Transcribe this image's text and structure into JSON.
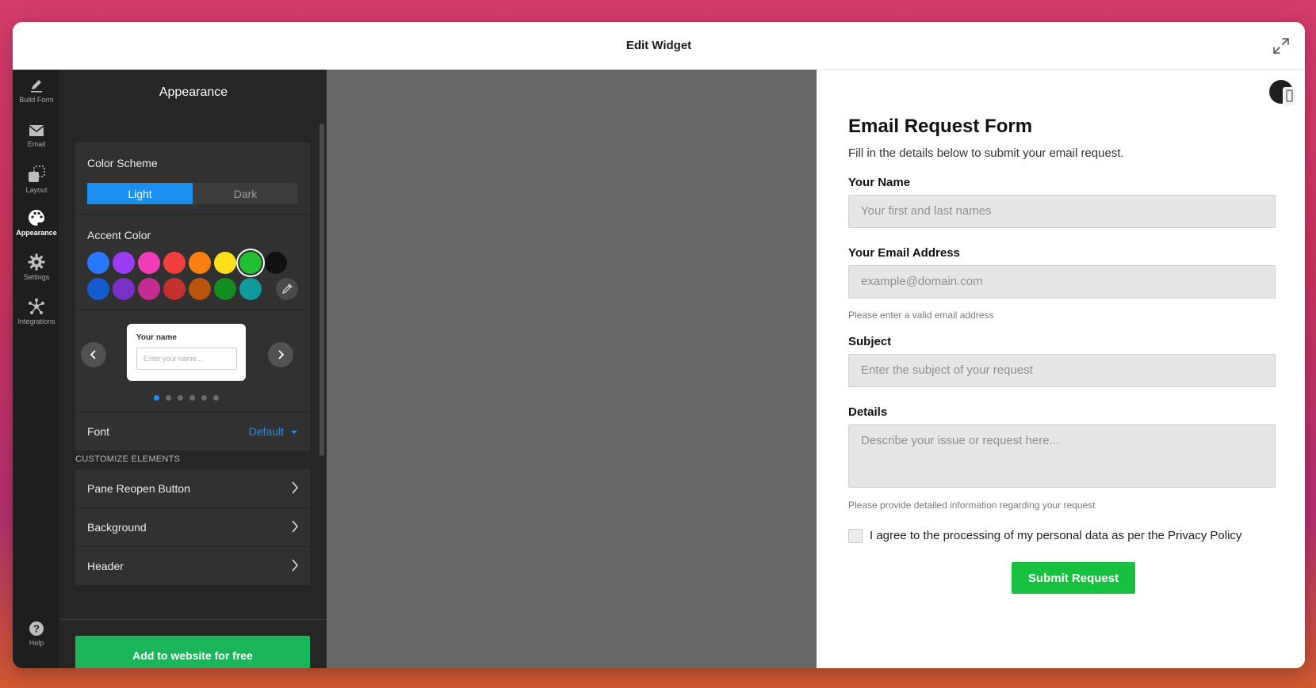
{
  "window": {
    "title": "Edit Widget"
  },
  "rail": {
    "items": [
      {
        "label": "Build Form",
        "icon": "pencil-icon"
      },
      {
        "label": "Email",
        "icon": "envelope-icon"
      },
      {
        "label": "Layout",
        "icon": "layout-icon"
      },
      {
        "label": "Appearance",
        "icon": "palette-icon",
        "active": true
      },
      {
        "label": "Settings",
        "icon": "gear-icon"
      },
      {
        "label": "Integrations",
        "icon": "integrations-icon"
      }
    ],
    "help_label": "Help"
  },
  "panel": {
    "title": "Appearance",
    "color_scheme": {
      "label": "Color Scheme",
      "options": [
        "Light",
        "Dark"
      ],
      "selected": "Light"
    },
    "accent": {
      "label": "Accent Color",
      "row1": [
        "#2979ff",
        "#9b3cf5",
        "#f23bb6",
        "#f23d3d",
        "#ff7f11",
        "#ffe11a",
        "#1fbf2e",
        "#111111"
      ],
      "row2": [
        "#155bd0",
        "#7a2fc7",
        "#c42c8f",
        "#c42f2f",
        "#b8540b",
        "#138c21",
        "#0f9b9b"
      ],
      "selected": "#1fbf2e"
    },
    "preview": {
      "label": "Your name",
      "placeholder": "Enter your name...",
      "dots": 6,
      "active_dot": 0
    },
    "font": {
      "label": "Font",
      "value": "Default"
    },
    "customize_label": "CUSTOMIZE ELEMENTS",
    "elements": [
      "Pane Reopen Button",
      "Background",
      "Header"
    ],
    "cta_label": "Add to website for free"
  },
  "form": {
    "title": "Email Request Form",
    "subtitle": "Fill in the details below to submit your email request.",
    "name_label": "Your Name",
    "name_placeholder": "Your first and last names",
    "email_label": "Your Email Address",
    "email_placeholder": "example@domain.com",
    "email_hint": "Please enter a valid email address",
    "subject_label": "Subject",
    "subject_placeholder": "Enter the subject of your request",
    "details_label": "Details",
    "details_placeholder": "Describe your issue or request here...",
    "details_hint": "Please provide detailed information regarding your request",
    "consent_label": "I agree to the processing of my personal data as per the Privacy Policy",
    "submit_label": "Submit Request"
  },
  "colors": {
    "accent_blue": "#1b8ff0",
    "cta_green": "#1bb55a",
    "submit_green": "#17c13f"
  }
}
